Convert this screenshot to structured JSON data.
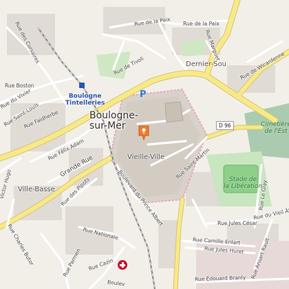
{
  "map": {
    "places": {
      "city": "Boulogne-sur-Mer",
      "old_town": "Vieille-Ville",
      "lower_town": "Ville-Basse",
      "district_ne": "Dernier-Sou"
    },
    "station": {
      "line1": "Boulogne",
      "line2": "Tintelleries"
    },
    "stadium": {
      "line1": "Stade de",
      "line2": "la Libération"
    },
    "cemetery": {
      "line1": "Cimetière",
      "line2": "de l'Est"
    },
    "road_shield": "D 96",
    "parking_symbol": "P",
    "streets": {
      "paix_n": "Rue de la Paix",
      "paix_ne": "Rue de la Paix",
      "tivoli": "Rue de Tivoli",
      "boston": "Rue Boston",
      "faidherbe": "Rue Faidherbe",
      "saint_louis": "Rue Saint-Louis",
      "vivier": "Rue du Vivier",
      "corsaires": "Rue des Corsaires",
      "felix_adam": "Rue Félix Adam",
      "grande_rue": "Grande Rue",
      "victor_hugo": "Victor Hugo",
      "pipots": "Rue des Pipots",
      "prince_albert": "Boulevard du Prince Albert",
      "saint_martin": "Rue Saint-Martin",
      "jules_cesar": "Rue Jules César",
      "vieil_atre": "Rue du Vieil Âtre",
      "camille_enlart": "Rue Camille Enlart",
      "jules_huret": "Rue Jules Huret",
      "nationale": "Rue Nationale",
      "cazin": "Rue Cazin",
      "charles_butor": "Rue Charles Butor",
      "edouard_branly": "Rue Édouard Branly",
      "wicardenne": "Rue de Wicardenne",
      "marguet": "Rue Marguet",
      "le_glay": "Rue Le Glay",
      "ansart_rault": "Rue Ansart Rault",
      "boulevard_partial": "Boulev",
      "parmen_partial": "Rue Parmen"
    }
  }
}
